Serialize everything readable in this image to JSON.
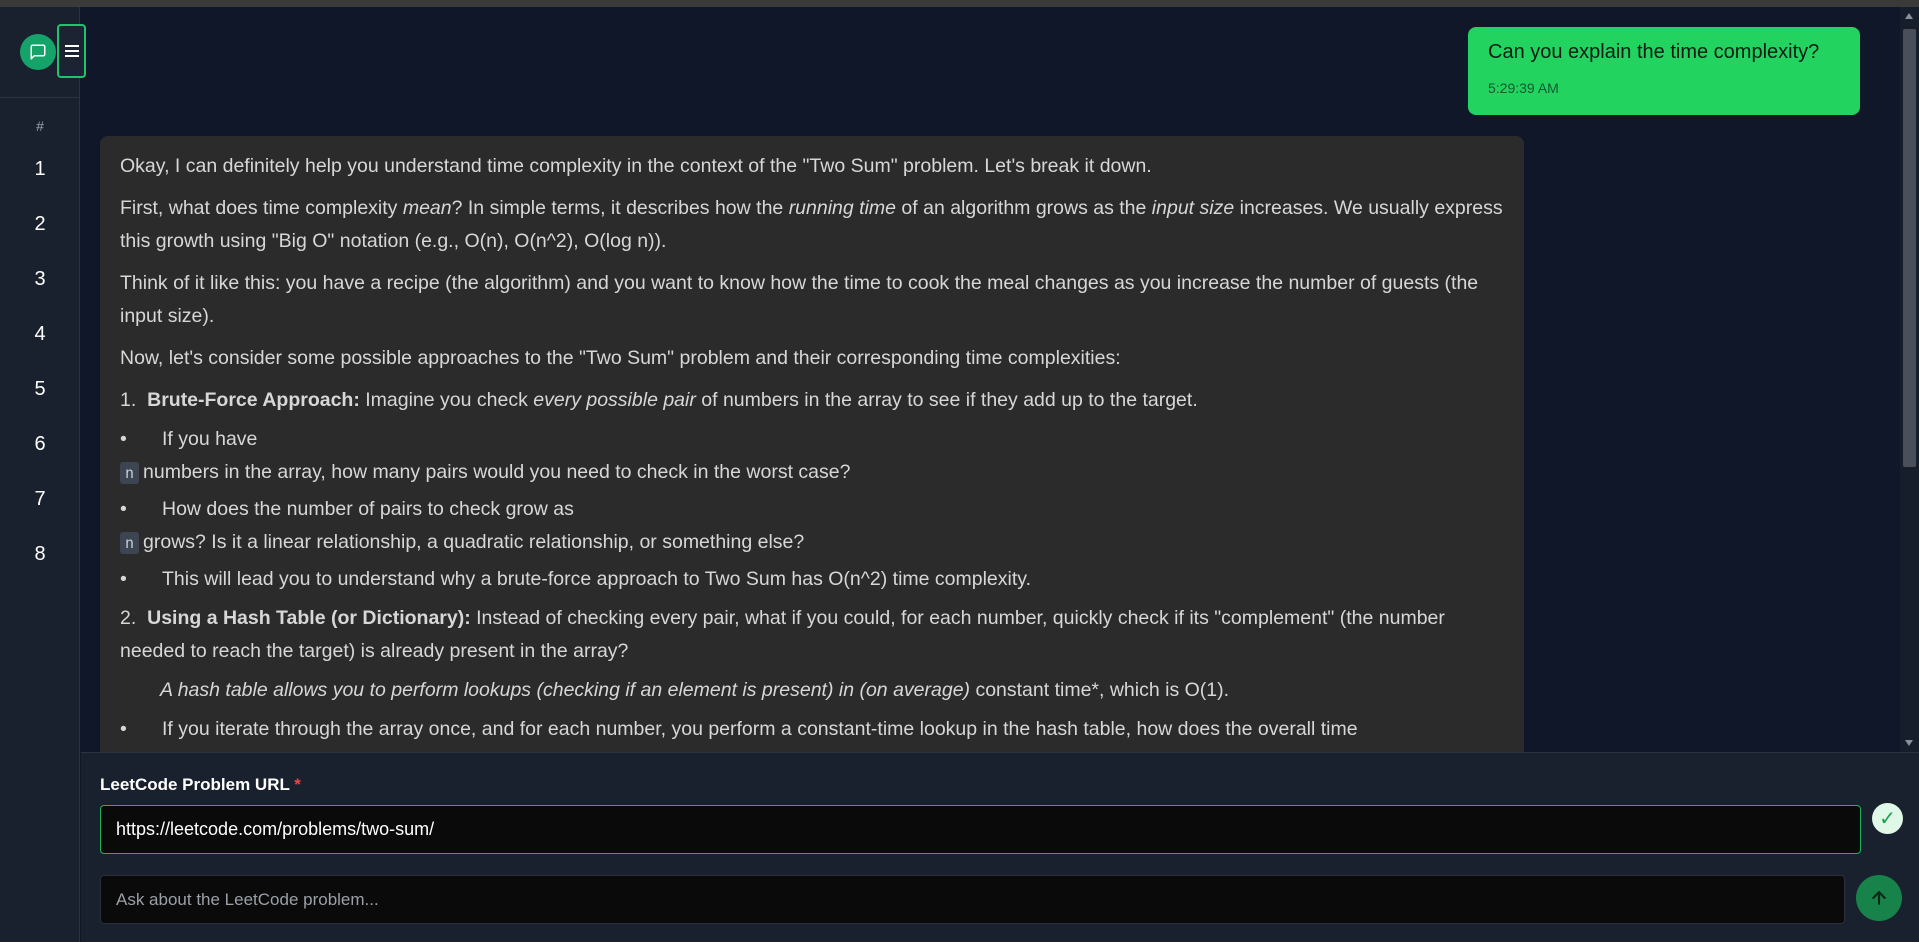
{
  "sidebar": {
    "header": "#",
    "items": [
      "1",
      "2",
      "3",
      "4",
      "5",
      "6",
      "7",
      "8"
    ]
  },
  "user_message": {
    "text": "Can you explain the time complexity?",
    "time": "5:29:39 AM"
  },
  "bot_message": {
    "p1": "Okay, I can definitely help you understand time complexity in the context of the \"Two Sum\" problem. Let's break it down.",
    "p2_a": "First, what does time complexity ",
    "p2_em1": "mean",
    "p2_b": "? In simple terms, it describes how the ",
    "p2_em2": "running time",
    "p2_c": " of an algorithm grows as the ",
    "p2_em3": "input size",
    "p2_d": " increases. We usually express this growth using \"Big O\" notation (e.g., O(n), O(n^2), O(log n)).",
    "p3": "Think of it like this: you have a recipe (the algorithm) and you want to know how the time to cook the meal changes as you increase the number of guests (the input size).",
    "p4": "Now, let's consider some possible approaches to the \"Two Sum\" problem and their corresponding time complexities:",
    "item1_num": "1.",
    "item1_bold": "Brute-Force Approach:",
    "item1_a": " Imagine you check ",
    "item1_em": "every possible pair",
    "item1_b": " of numbers in the array to see if they add up to the target.",
    "b1_a": "If you have",
    "b1_code": "n",
    "b1_b": "numbers in the array, how many pairs would you need to check in the worst case?",
    "b2_a": "How does the number of pairs to check grow as",
    "b2_code": "n",
    "b2_b": "grows?  Is it a linear relationship, a quadratic relationship, or something else?",
    "b3": "This will lead you to understand why a brute-force approach to Two Sum has O(n^2) time complexity.",
    "item2_num": "2.",
    "item2_bold": "Using a Hash Table (or Dictionary):",
    "item2_text": "  Instead of checking every pair, what if you could, for each number, quickly check if its \"complement\" (the number needed to reach the target) is already present in the array?",
    "hash_em": "A hash table allows you to perform lookups (checking if an element is present) in (on average)",
    "hash_rest": " constant time*, which is O(1).",
    "b4": "If you iterate through the array once, and for each number, you perform a constant-time lookup in the hash table, how does the overall time"
  },
  "bullet_char": "•",
  "form": {
    "url_label": "LeetCode Problem URL",
    "required_mark": "*",
    "url_value": "https://leetcode.com/problems/two-sum/",
    "valid_mark": "✓",
    "ask_placeholder": "Ask about the LeetCode problem..."
  },
  "colors": {
    "accent": "#23d360",
    "background": "#0f1729",
    "bot_bubble": "#2b2b2b"
  }
}
